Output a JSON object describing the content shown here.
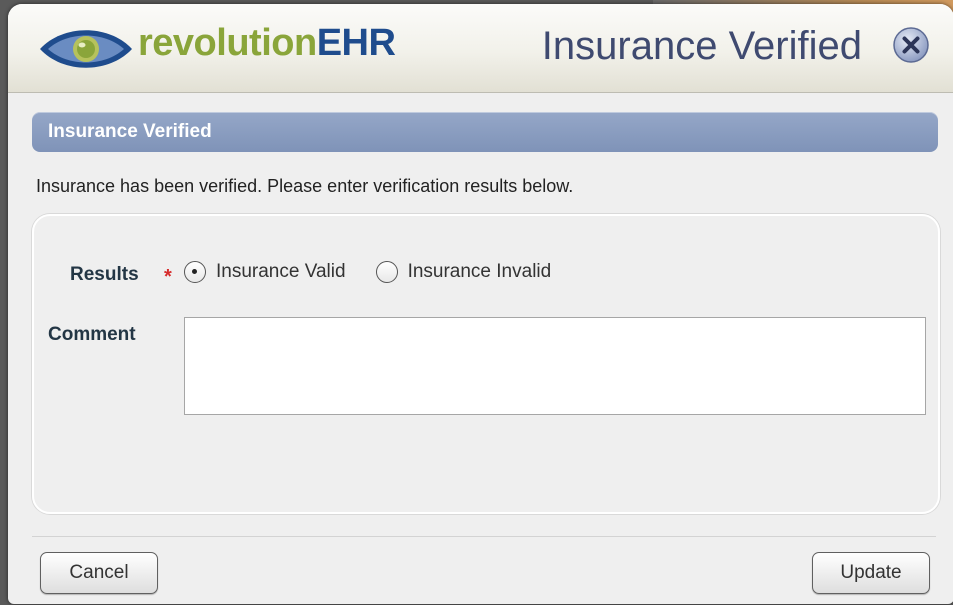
{
  "app": {
    "logo_part1": "revolution",
    "logo_part2": "EHR",
    "dialog_title": "Insurance Verified"
  },
  "section": {
    "header": "Insurance Verified",
    "intro": "Insurance has been verified. Please enter verification results below."
  },
  "form": {
    "results_label": "Results",
    "required_marker": "*",
    "options": [
      {
        "label": "Insurance Valid",
        "selected": true
      },
      {
        "label": "Insurance Invalid",
        "selected": false
      }
    ],
    "comment_label": "Comment",
    "comment_value": ""
  },
  "buttons": {
    "cancel": "Cancel",
    "update": "Update"
  },
  "colors": {
    "accent_header": "#8a9dc0",
    "logo_green": "#8aa53a",
    "logo_blue": "#1f4c8d",
    "required": "#d62b2b"
  },
  "icons": {
    "logo": "eye-logo-icon",
    "close": "close-circle-icon"
  }
}
